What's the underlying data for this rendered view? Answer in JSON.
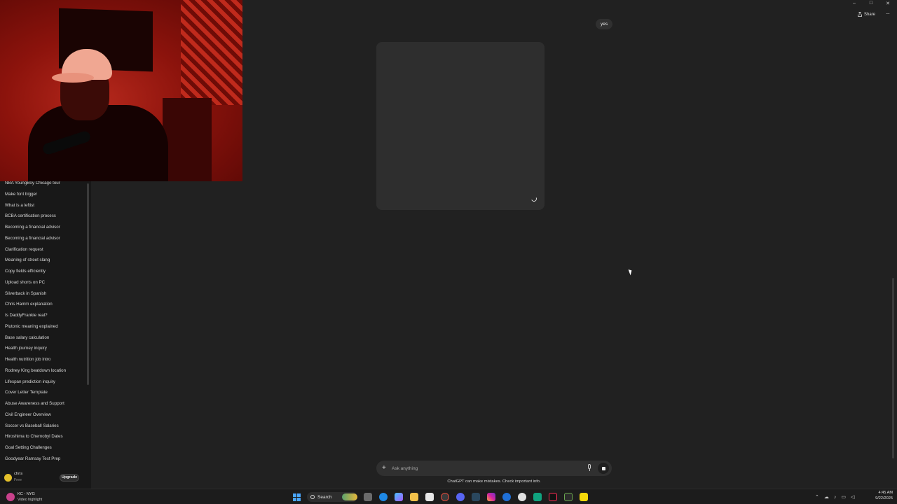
{
  "window": {
    "minimize": "–",
    "maximize": "□",
    "close": "✕"
  },
  "header": {
    "share_label": "Share",
    "more_label": "···"
  },
  "sidebar": {
    "chats": [
      "NBA YoungBoy Chicago tour",
      "Make font bigger",
      "What is a leftist",
      "BCBA certification process",
      "Becoming a financial advisor",
      "Becoming a financial advisor",
      "Clarification request",
      "Meaning of street slang",
      "Copy fields efficiently",
      "Upload shorts on PC",
      "Silverback in Spanish",
      "Chris Hamm explanation",
      "Is DaddyFrankie real?",
      "Plutonic meaning explained",
      "Base salary calculation",
      "Health journey inquiry",
      "Health nutrition job intro",
      "Rodney King beatdown location",
      "Lifespan prediction inquiry",
      "Cover Letter Template",
      "Abuse Awareness and Support",
      "Civil Engineer Overview",
      "Soccer vs Baseball Salaries",
      "Hiroshima to Chernobyl Dates",
      "Goal Setting Challenges",
      "Goodyear Ramsay Test Prep"
    ],
    "user": {
      "name": "chris",
      "plan": "Free",
      "upgrade_label": "Upgrade"
    }
  },
  "conversation": {
    "user_message": "yes"
  },
  "composer": {
    "plus": "+",
    "placeholder": "Ask anything",
    "disclaimer": "ChatGPT can make mistakes. Check important info."
  },
  "taskbar": {
    "weather_title": "KC - NYG",
    "weather_subtitle": "Video highlight",
    "search_label": "Search",
    "time": "4:45 AM",
    "date": "9/22/2025"
  },
  "colors": {
    "background": "#212121",
    "sidebar": "#181818",
    "image_placeholder": "#2e2e2e",
    "accent_user": "#e4c02a"
  }
}
